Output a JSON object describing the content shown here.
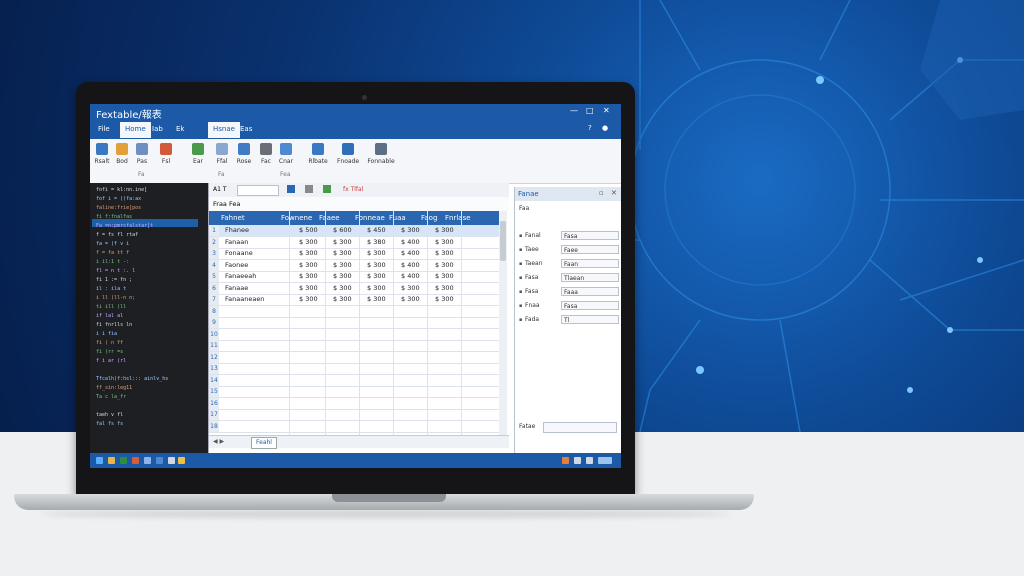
{
  "window": {
    "title": "Fextable/報表"
  },
  "window_controls": [
    "—",
    "□",
    "✕"
  ],
  "menu": [
    {
      "label": "File",
      "active": false
    },
    {
      "label": "Home",
      "active": true
    },
    {
      "label": "Iab",
      "active": false
    },
    {
      "label": "Ek",
      "active": false
    },
    {
      "label": "Hsnae",
      "active": true
    },
    {
      "label": "Eas",
      "active": false
    }
  ],
  "ribbon": {
    "buttons": [
      {
        "label": "Rsalt",
        "color": "#3b78c4"
      },
      {
        "label": "Bod",
        "color": "#e2a03a"
      },
      {
        "label": "Pas",
        "color": "#6d8fc1"
      },
      {
        "label": "Fsl",
        "color": "#d05a3a"
      },
      {
        "label": "Ear",
        "color": "#4a9a4a"
      },
      {
        "label": "Ffal",
        "color": "#8aa7d0"
      },
      {
        "label": "Rose",
        "color": "#3f7cc5"
      },
      {
        "label": "Fac",
        "color": "#6a6f77"
      },
      {
        "label": "Cnar",
        "color": "#4d8ad0"
      },
      {
        "label": "Rlbate",
        "color": "#3b78c4"
      },
      {
        "label": "Fnoade",
        "color": "#2f6eb8"
      },
      {
        "label": "Fonnable",
        "color": "#5c6f85"
      }
    ],
    "groups": [
      "Fa",
      "Fa",
      "Fea"
    ]
  },
  "code_pane": {
    "lines": [
      "fofi = kl:nn.ine[",
      "fof i = ((fa:ax",
      "  faline:frie[pos",
      "  fi f:fnalfas",
      "  Fa =n:pmrcfalstar[t",
      "  f =  fs fl rtaf",
      "  fa = (f  v  i",
      "  f = fa tt  f",
      "  i  il:1 t -:",
      "  fl = n  t :. l",
      "  fi 1 :=   fn ;",
      "  il :  ila t",
      "  i ll  (ll-n n;",
      "  ti  ill  (ll",
      "  if  lal  al",
      "  fi  fnrlls  ln",
      "  i  i   fia",
      "  fi  (  n ff",
      "  fi  (rr  =s",
      "  f  i  ar  (rl",
      "",
      "  Tfcalh(f:hsl:::  ainlv_hs",
      "  ff_sin:leg11",
      "  Ta c   la_fr",
      "",
      "  taeh  v  fl",
      "  fal  fs  fs"
    ]
  },
  "sheet": {
    "name_box": "A1 T",
    "formula_bar": "fx  Tlfal",
    "toolbar_hint": "Fraa  Fea",
    "columns": [
      "Fahnet",
      "Fownene",
      "Faaee",
      "Fonneae",
      "Fuaa",
      "Faog",
      "Fnrlase"
    ],
    "rows": [
      [
        "Fhanee",
        "$ 500",
        "$ 600",
        "$ 450",
        "$ 300",
        "$ 300"
      ],
      [
        "Fanaan",
        "$ 300",
        "$ 300",
        "$ 380",
        "$ 400",
        "$ 300"
      ],
      [
        "Fonaane",
        "$ 300",
        "$ 300",
        "$ 300",
        "$ 400",
        "$ 300"
      ],
      [
        "Faonee",
        "$ 300",
        "$ 300",
        "$ 300",
        "$ 400",
        "$ 300"
      ],
      [
        "Fanaeeah",
        "$ 300",
        "$ 300",
        "$ 300",
        "$ 400",
        "$ 300"
      ],
      [
        "Fanaae",
        "$ 300",
        "$ 300",
        "$ 300",
        "$ 300",
        "$ 300"
      ],
      [
        "Fanaaneaen",
        "$ 300",
        "$ 300",
        "$ 300",
        "$ 300",
        "$ 300"
      ]
    ],
    "row_numbers": [
      "1",
      "2",
      "3",
      "4",
      "5",
      "6",
      "7",
      "8",
      "9",
      "10",
      "11",
      "12",
      "13",
      "14",
      "15",
      "16",
      "17",
      "18"
    ],
    "active_tab": "Feahl"
  },
  "properties": {
    "title": "Fanae",
    "subtitle": "Faa",
    "rows": [
      {
        "label": "Fanal",
        "value": "Fasa"
      },
      {
        "label": "Taee",
        "value": "Faee"
      },
      {
        "label": "Taean",
        "value": "Faan"
      },
      {
        "label": "Fasa",
        "value": "Tlaean"
      },
      {
        "label": "Fasa",
        "value": "Faaa"
      },
      {
        "label": "Fnaa",
        "value": "Fasa"
      },
      {
        "label": "Fada",
        "value": "Tl"
      }
    ],
    "footer_label": "Fatae"
  },
  "colors": {
    "accent": "#1c5aa8",
    "header_blue": "#2b67b1",
    "selected_row": "#d6e6f8",
    "code_bg": "#1d1f22"
  }
}
